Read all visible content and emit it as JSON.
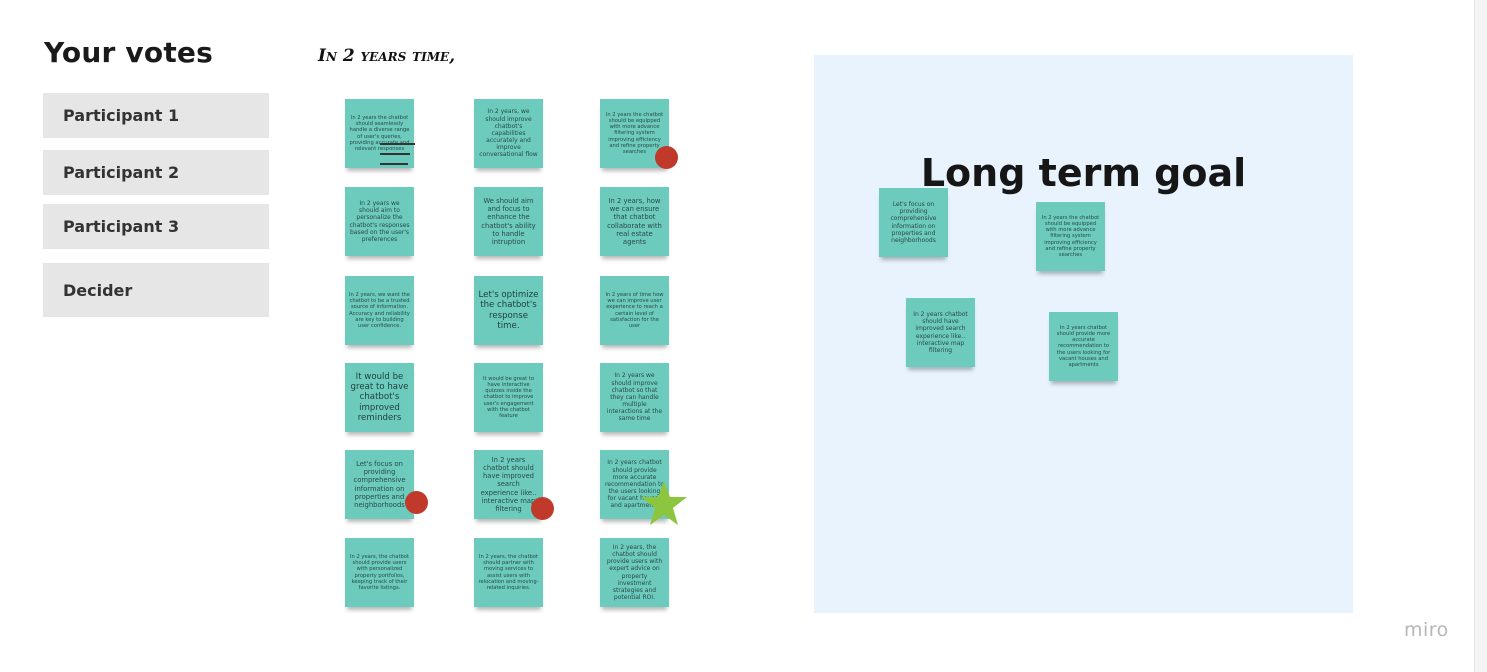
{
  "votes_panel": {
    "title": "Your votes",
    "participants": [
      "Participant 1",
      "Participant 2",
      "Participant 3",
      "Decider"
    ]
  },
  "board": {
    "heading": "In 2 years time,",
    "notes": [
      "In 2 years the chatbot should seamlessly handle a diverse range of user's queries, providing accurate and relevant responses",
      "In 2 years, we should improve chatbot's capabilities accurately and improve conversational flow",
      "In 2 years the chatbot should be equipped with more advance filtering system improving efficiency and refine property searches",
      "In 2 years we should aim to personalize the chatbot's responses based on the user's preferences",
      "We should aim and focus to enhance the chatbot's ability to handle intruption",
      "In 2 years, how we can ensure that chatbot collaborate with real estate agents",
      "In 2 years, we want the chatbot to be a trusted source of information. Accuracy and reliability are key to building user confidence.",
      "Let's optimize the chatbot's response time.",
      "In 2 years of time how we can improve user experience to reach a certain level of satisfaction for the user",
      "It would be great to have chatbot's improved reminders",
      "It would be great to have interactive quizzes inside the chatbot to improve user's engagement with the chatbot feature",
      "In 2 years we should improve chatbot so that they can handle multiple interactions at the same time",
      "Let's focus on providing comprehensive information on properties and neighborhoods",
      "In 2 years chatbot should have improved search experience like.. interactive map filtering",
      "In 2 years chatbot should provide more accurate recommendation to the users looking for vacant houses and apartments",
      "In 2 years, the chatbot should provide users with personalized property portfolios, keeping track of their favorite listings.",
      "In 2 years, the chatbot should partner with moving services to assist users with relocation and moving-related inquiries.",
      "In 2 years, the chatbot should provide users with expert advice on property investment strategies and potential ROI."
    ]
  },
  "goal_panel": {
    "title": "Long term goal",
    "notes": [
      "Let's focus on providing comprehensive information on properties and neighborhoods",
      "In 2 years the chatbot should be equipped with more advance filtering system improving efficiency and refine property searches",
      "In 2 years chatbot should have improved search experience like.. interactive map filtering",
      "In 2 years chatbot should provide more accurate recommendation to the users looking for vacant houses and apartments"
    ]
  },
  "brand": {
    "logo_text": "miro"
  },
  "colors": {
    "sticky": "#6ccbbd",
    "vote_dot": "#c0392b",
    "star": "#8cc63f",
    "goal_background": "#e8f3fd",
    "participant_button": "#e6e6e6"
  }
}
